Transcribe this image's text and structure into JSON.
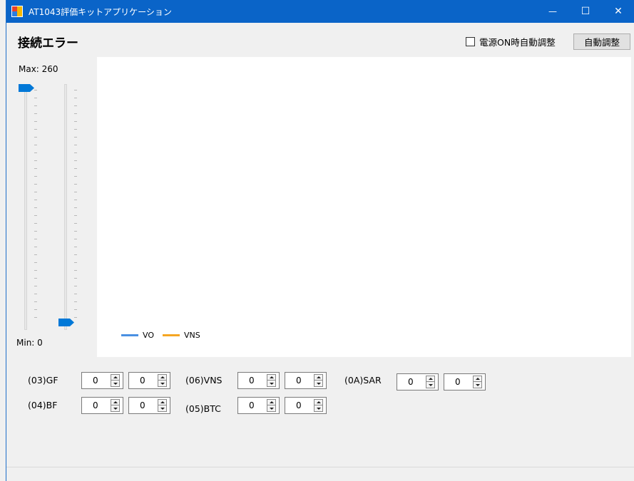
{
  "window": {
    "title": "AT1043評価キットアプリケーション",
    "minimize_icon": "minimize-icon",
    "maximize_icon": "maximize-icon",
    "close_icon": "close-icon",
    "close_glyph": "✕",
    "minimize_glyph": "—",
    "maximize_glyph": "☐"
  },
  "header": {
    "status_text": "接続エラー",
    "auto_on_power_label": "電源ON時自動調整",
    "auto_on_power_checked": false,
    "auto_adjust_button": "自動調整"
  },
  "sliders": {
    "max_label": "Max: 260",
    "min_label": "Min: 0",
    "left_slider_value": 260,
    "right_slider_value": 0,
    "range": [
      0,
      260
    ]
  },
  "chart": {
    "legend": [
      {
        "name": "VO",
        "color": "#4a90e2"
      },
      {
        "name": "VNS",
        "color": "#f5a623"
      }
    ]
  },
  "registers": [
    {
      "label": "(03)GF",
      "value1": "0",
      "value2": "0"
    },
    {
      "label": "(04)BF",
      "value1": "0",
      "value2": "0"
    },
    {
      "label": "(06)VNS",
      "value1": "0",
      "value2": "0"
    },
    {
      "label": "(05)BTC",
      "value1": "0",
      "value2": "0"
    },
    {
      "label": "(0A)SAR",
      "value1": "0",
      "value2": "0"
    }
  ],
  "colors": {
    "titlebar": "#0a64c8",
    "slider_thumb": "#0078d7",
    "background": "#f0f0f0"
  }
}
